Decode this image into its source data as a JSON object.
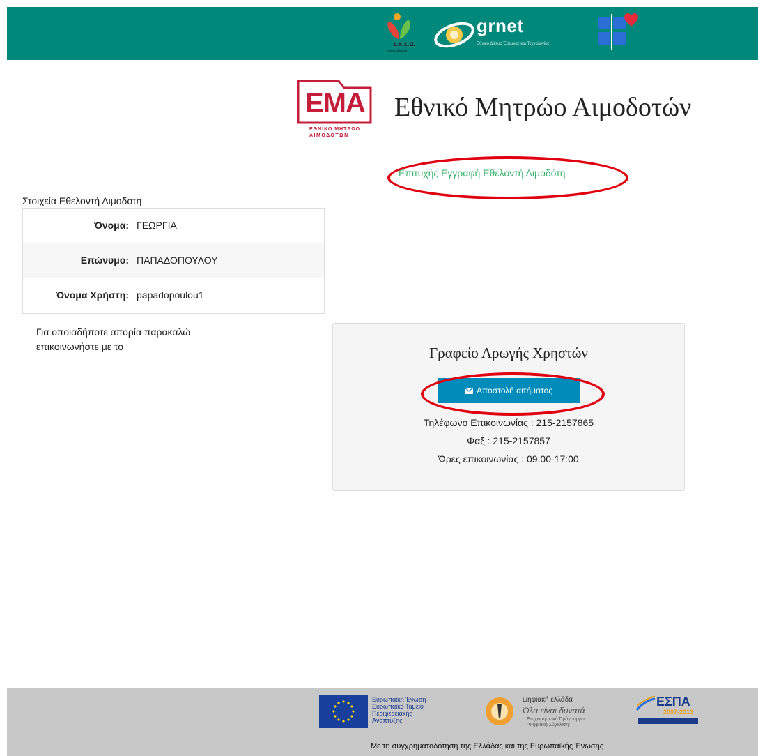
{
  "header": {
    "logos": [
      {
        "name": "ekea-logo",
        "label": "ε.κ.ε.α.",
        "subtext": "www.ekea.gr"
      },
      {
        "name": "grnet-logo",
        "label": "grnet",
        "tagline": "Εθνικό Δίκτυο Έρευνας και Τεχνολογίας"
      },
      {
        "name": "ministry-of-health-logo"
      }
    ]
  },
  "ema_logo": {
    "letters": "ΕΜΑ",
    "line1": "ΕΘΝΙΚΟ ΜΗΤΡΩΟ",
    "line2": "ΑΙΜΟΔΟΤΩΝ"
  },
  "page_title": "Εθνικό Μητρώο Αιμοδοτών",
  "success_message": "Επιτυχής Εγγραφή Εθελοντή Αιμοδότη",
  "details": {
    "title": "Στοιχεία Εθελοντή Αιμοδότη",
    "rows": [
      {
        "label": "Όνομα:",
        "value": "ΓΕΩΡΓΙΑ"
      },
      {
        "label": "Επώνυμο:",
        "value": "ΠΑΠΑΔΟΠΟΥΛΟΥ"
      },
      {
        "label": "Όνομα Χρήστη:",
        "value": "papadopoulou1"
      }
    ]
  },
  "contact_note": "Για οποιαδήποτε απορία παρακαλώ επικοινωνήστε με το",
  "help_desk": {
    "title": "Γραφείο Αρωγής Χρηστών",
    "button_label": "Αποστολή αιτήματος",
    "button_icon": "envelope-icon",
    "lines": [
      "Τηλέφωνο Επικοινωνίας : 215-2157865",
      "Φαξ : 215-2157857",
      "Ώρες επικοινωνίας : 09:00-17:00"
    ]
  },
  "footer": {
    "eu_text": [
      "Ευρωπαϊκή Ένωση",
      "Ευρωπαϊκό Ταμείο",
      "Περιφερειακής",
      "Ανάπτυξης"
    ],
    "digital_text": [
      "ψηφιακή ελλάδα",
      "Όλα είναι δυνατά",
      "Επιχειρησιακό Πρόγραμμα",
      "\"Ψηφιακή Σύγκλιση\""
    ],
    "espa_text": [
      "ΕΣΠΑ",
      "2007-2013"
    ],
    "caption": "Με τη συγχρηματοδότηση της Ελλάδας και της Ευρωπαϊκής Ένωσης"
  },
  "colors": {
    "header_bg": "#00897b",
    "accent_button": "#008cba",
    "success_text": "#3cb371",
    "annotation_red": "#e00010",
    "ema_red": "#c41e3a",
    "footer_bg": "#c8c8c8"
  }
}
